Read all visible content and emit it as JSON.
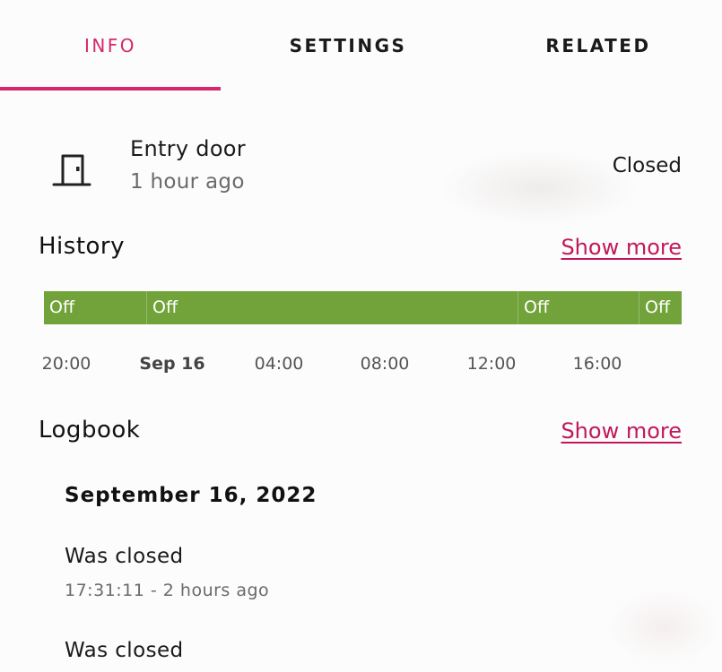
{
  "tabs": [
    {
      "label": "INFO",
      "active": true
    },
    {
      "label": "SETTINGS",
      "active": false
    },
    {
      "label": "RELATED",
      "active": false
    }
  ],
  "accent_color": "#d6286b",
  "entity": {
    "icon": "door-closed-icon",
    "name": "Entry door",
    "last_changed": "1 hour ago",
    "state": "Closed"
  },
  "history": {
    "title": "History",
    "show_more": "Show more",
    "bar_color": "#72a33a",
    "segments": [
      {
        "label": "Off"
      },
      {
        "label": "Off"
      },
      {
        "label": "Off"
      },
      {
        "label": "Off"
      }
    ],
    "axis_labels": [
      "20:00",
      "Sep 16",
      "04:00",
      "08:00",
      "12:00",
      "16:00"
    ]
  },
  "logbook": {
    "title": "Logbook",
    "show_more": "Show more",
    "date": "September 16, 2022",
    "entries": [
      {
        "message": "Was closed",
        "time": "17:31:11 - 2 hours ago"
      },
      {
        "message": "Was closed"
      }
    ]
  }
}
